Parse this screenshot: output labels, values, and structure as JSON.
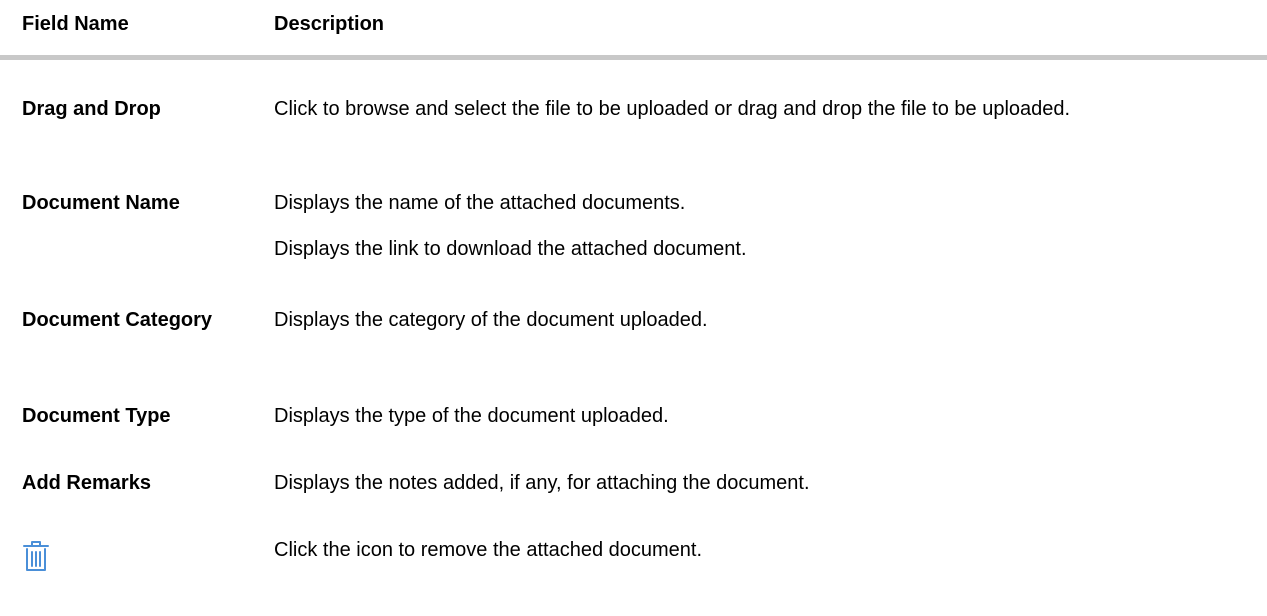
{
  "header": {
    "field_name": "Field Name",
    "description": "Description"
  },
  "rows": [
    {
      "field": "Drag and Drop",
      "descriptions": [
        "Click to browse and select the file to be uploaded or drag and drop the file to be uploaded."
      ]
    },
    {
      "field": "Document Name",
      "descriptions": [
        "Displays the name of the attached documents.",
        "Displays the link to download the attached document."
      ]
    },
    {
      "field": "Document Category",
      "descriptions": [
        "Displays the category of the document uploaded."
      ]
    },
    {
      "field": "Document Type",
      "descriptions": [
        "Displays the type of the document uploaded."
      ]
    },
    {
      "field": "Add Remarks",
      "descriptions": [
        "Displays the notes added, if any, for attaching the document."
      ]
    },
    {
      "field_icon": "trash-icon",
      "descriptions": [
        "Click the icon to remove the attached document."
      ]
    }
  ],
  "colors": {
    "header_rule": "#c8c8c8",
    "icon": "#4a8fd8"
  }
}
